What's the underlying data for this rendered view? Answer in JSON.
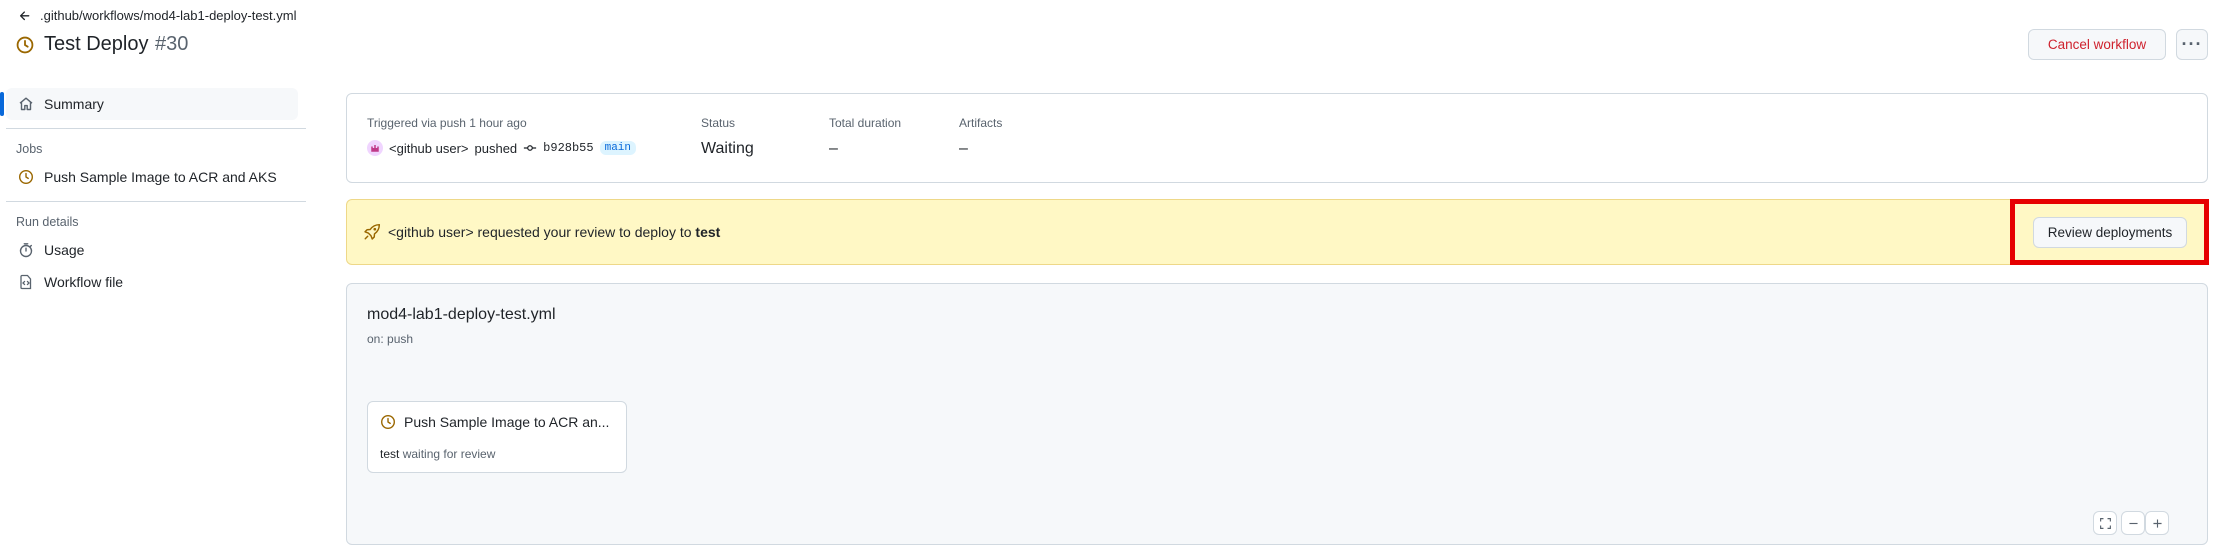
{
  "header": {
    "back_path": ".github/workflows/mod4-lab1-deploy-test.yml",
    "run_title": "Test Deploy",
    "run_number": "#30",
    "cancel_label": "Cancel workflow",
    "more_label": "···"
  },
  "sidebar": {
    "summary_label": "Summary",
    "jobs_heading": "Jobs",
    "jobs": [
      {
        "label": "Push Sample Image to ACR and AKS",
        "icon": "clock-icon"
      }
    ],
    "run_details_heading": "Run details",
    "run_details": [
      {
        "label": "Usage",
        "icon": "stopwatch-icon"
      },
      {
        "label": "Workflow file",
        "icon": "file-code-icon"
      }
    ]
  },
  "summary": {
    "trigger_label": "Triggered via push 1 hour ago",
    "actor": "<github user>",
    "action": "pushed",
    "commit_sha": "b928b55",
    "branch": "main",
    "status_label": "Status",
    "status_value": "Waiting",
    "duration_label": "Total duration",
    "duration_value": "–",
    "artifacts_label": "Artifacts",
    "artifacts_value": "–"
  },
  "review": {
    "actor": "<github user>",
    "message": "requested your review to deploy to",
    "environment": "test",
    "button_label": "Review deployments"
  },
  "graph": {
    "workflow_file": "mod4-lab1-deploy-test.yml",
    "trigger": "on: push",
    "job": {
      "title": "Push Sample Image to ACR an...",
      "environment": "test",
      "status_text": "waiting for review"
    }
  },
  "colors": {
    "waiting_icon": "#9a6700",
    "danger_text": "#cf222e",
    "banner_bg": "#fff8c5",
    "highlight": "#e60000",
    "accent": "#0969da"
  }
}
